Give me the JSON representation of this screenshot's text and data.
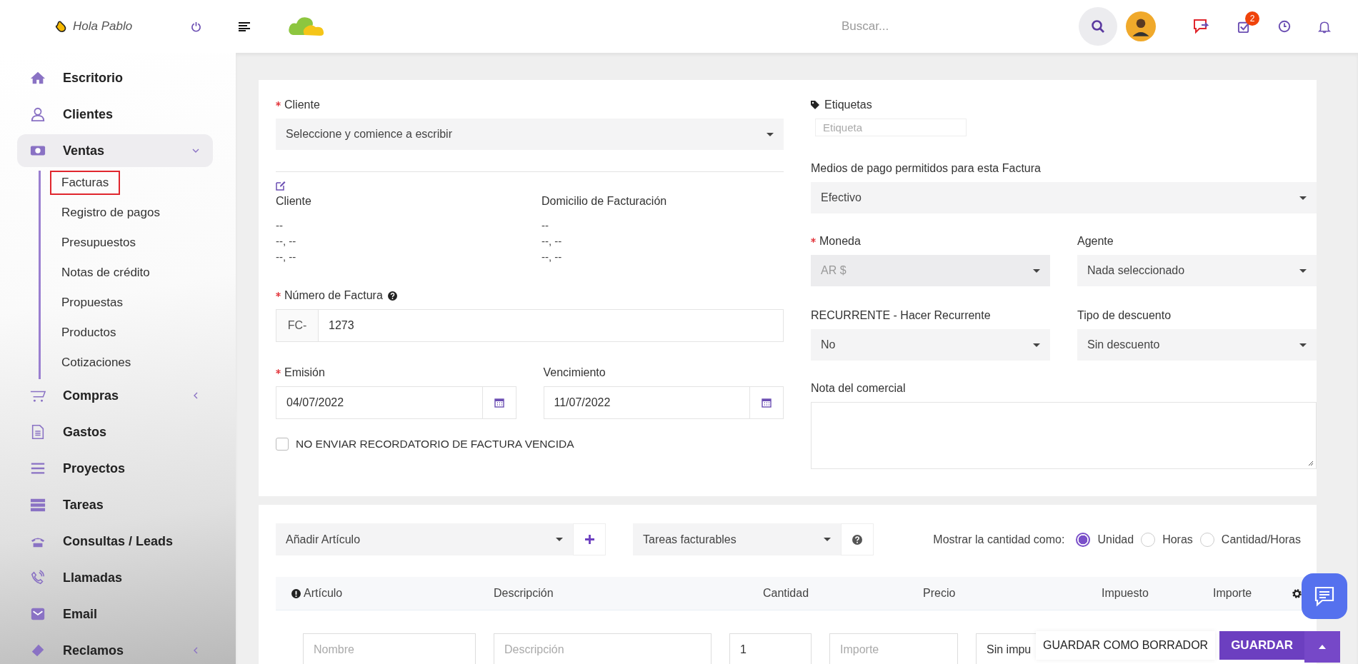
{
  "topbar": {
    "greeting": "Hola Pablo",
    "search": {
      "placeholder": "Buscar..."
    },
    "tasks_badge": "2"
  },
  "sidebar": {
    "items": [
      {
        "label": "Escritorio",
        "kind": "link"
      },
      {
        "label": "Clientes",
        "kind": "link"
      },
      {
        "label": "Ventas",
        "kind": "group",
        "expanded": true,
        "children": [
          {
            "label": "Facturas",
            "selected": true
          },
          {
            "label": "Registro de pagos",
            "selected": false
          },
          {
            "label": "Presupuestos",
            "selected": false
          },
          {
            "label": "Notas de crédito",
            "selected": false
          },
          {
            "label": "Propuestas",
            "selected": false
          },
          {
            "label": "Productos",
            "selected": false
          },
          {
            "label": "Cotizaciones",
            "selected": false
          }
        ]
      },
      {
        "label": "Compras",
        "kind": "group",
        "expanded": false
      },
      {
        "label": "Gastos",
        "kind": "link"
      },
      {
        "label": "Proyectos",
        "kind": "link"
      },
      {
        "label": "Tareas",
        "kind": "link"
      },
      {
        "label": "Consultas / Leads",
        "kind": "link"
      },
      {
        "label": "Llamadas",
        "kind": "link"
      },
      {
        "label": "Email",
        "kind": "link"
      },
      {
        "label": "Reclamos",
        "kind": "group",
        "expanded": false
      }
    ]
  },
  "invoice": {
    "client": {
      "label": "Cliente",
      "required": true,
      "value": "Seleccione y comience a escribir"
    },
    "client_details": [
      {
        "heading": "Cliente",
        "lines": [
          "--",
          "--, --",
          "--, --"
        ]
      },
      {
        "heading": "Domicilio de Facturación",
        "lines": [
          "--",
          "--, --",
          "--, --"
        ]
      }
    ],
    "number": {
      "label": "Número de Factura",
      "required": true,
      "prefix": "FC-",
      "value": "1273"
    },
    "dates": [
      {
        "label": "Emisión",
        "required": true,
        "value": "04/07/2022"
      },
      {
        "label": "Vencimiento",
        "required": false,
        "value": "11/07/2022"
      }
    ],
    "no_reminder": {
      "label": "NO ENVIAR RECORDATORIO DE FACTURA VENCIDA",
      "checked": false
    },
    "tags": {
      "label": "Etiquetas",
      "placeholder": "Etiqueta"
    },
    "payment_modes": {
      "label": "Medios de pago permitidos para esta Factura",
      "value": "Efectivo"
    },
    "selects": [
      {
        "label": "Moneda",
        "required": true,
        "value": "AR $",
        "disabled": true
      },
      {
        "label": "Agente",
        "required": false,
        "value": "Nada seleccionado",
        "disabled": false
      },
      {
        "label": "RECURRENTE - Hacer Recurrente",
        "required": false,
        "value": "No",
        "disabled": false
      },
      {
        "label": "Tipo de descuento",
        "required": false,
        "value": "Sin descuento",
        "disabled": false
      }
    ],
    "note": {
      "label": "Nota del comercial"
    }
  },
  "items": {
    "add_item": {
      "value": "Añadir Artículo"
    },
    "billable_tasks": {
      "value": "Tareas facturables"
    },
    "quantity_as": {
      "label": "Mostrar la cantidad como:",
      "options": [
        {
          "label": "Unidad",
          "selected": true
        },
        {
          "label": "Horas",
          "selected": false
        },
        {
          "label": "Cantidad/Horas",
          "selected": false
        }
      ]
    },
    "columns": [
      "Artículo",
      "Descripción",
      "Cantidad",
      "Precio",
      "Impuesto",
      "Importe"
    ],
    "new_row": {
      "name_placeholder": "Nombre",
      "description_placeholder": "Descripción",
      "quantity": "1",
      "price_placeholder": "Importe",
      "tax": "Sin impu"
    }
  },
  "actions": {
    "draft": "GUARDAR COMO BORRADOR",
    "save": "GUARDAR"
  }
}
